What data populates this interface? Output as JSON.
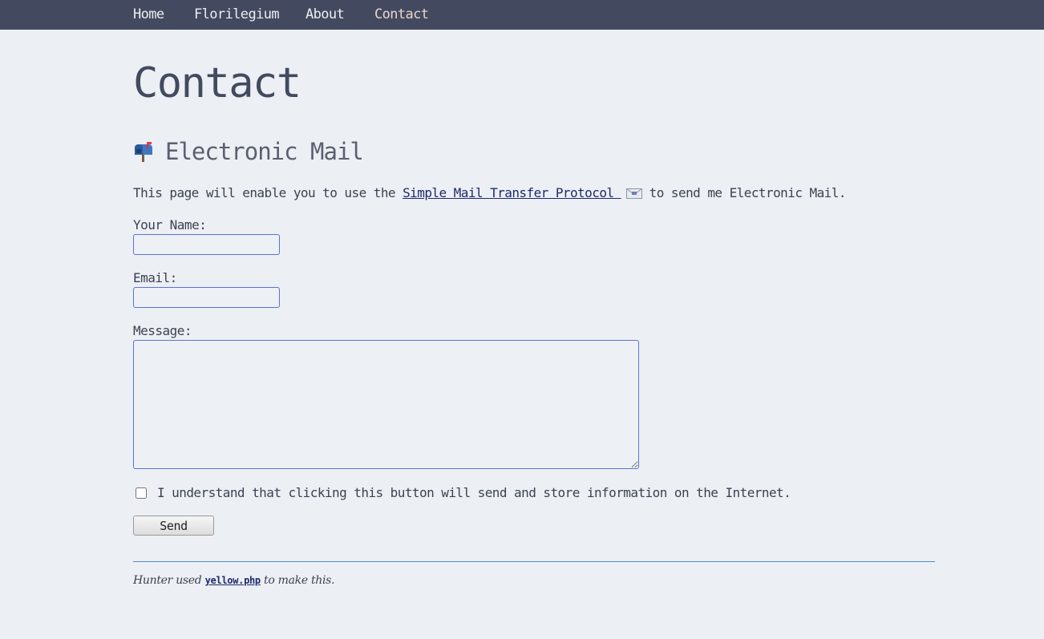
{
  "nav": {
    "items": [
      {
        "label": "Home"
      },
      {
        "label": "Florilegium"
      },
      {
        "label": "About"
      },
      {
        "label": "Contact",
        "active": true
      }
    ]
  },
  "page": {
    "title": "Contact"
  },
  "section": {
    "icon": "mailbox-icon",
    "heading": "Electronic Mail"
  },
  "intro": {
    "before": "This page will enable you to use the ",
    "link_text": "Simple Mail Transfer Protocol",
    "link_icon": "envelope-icon",
    "after": " to send me Electronic Mail."
  },
  "form": {
    "name_label": "Your Name:",
    "name_value": "",
    "email_label": "Email:",
    "email_value": "",
    "message_label": "Message:",
    "message_value": "",
    "consent_label": "I understand that clicking this button will send and store information on the Internet.",
    "consent_checked": false,
    "send_label": "Send"
  },
  "footer": {
    "before": "Hunter used ",
    "link_text": "yellow.php",
    "after": " to make this."
  },
  "colors": {
    "page_background": "#eceff4",
    "nav_background": "#434a5f",
    "nav_active": "#ebd3cf",
    "link": "#1e2a6b",
    "input_border": "#5e73cf",
    "rule": "#4b8fc8"
  }
}
